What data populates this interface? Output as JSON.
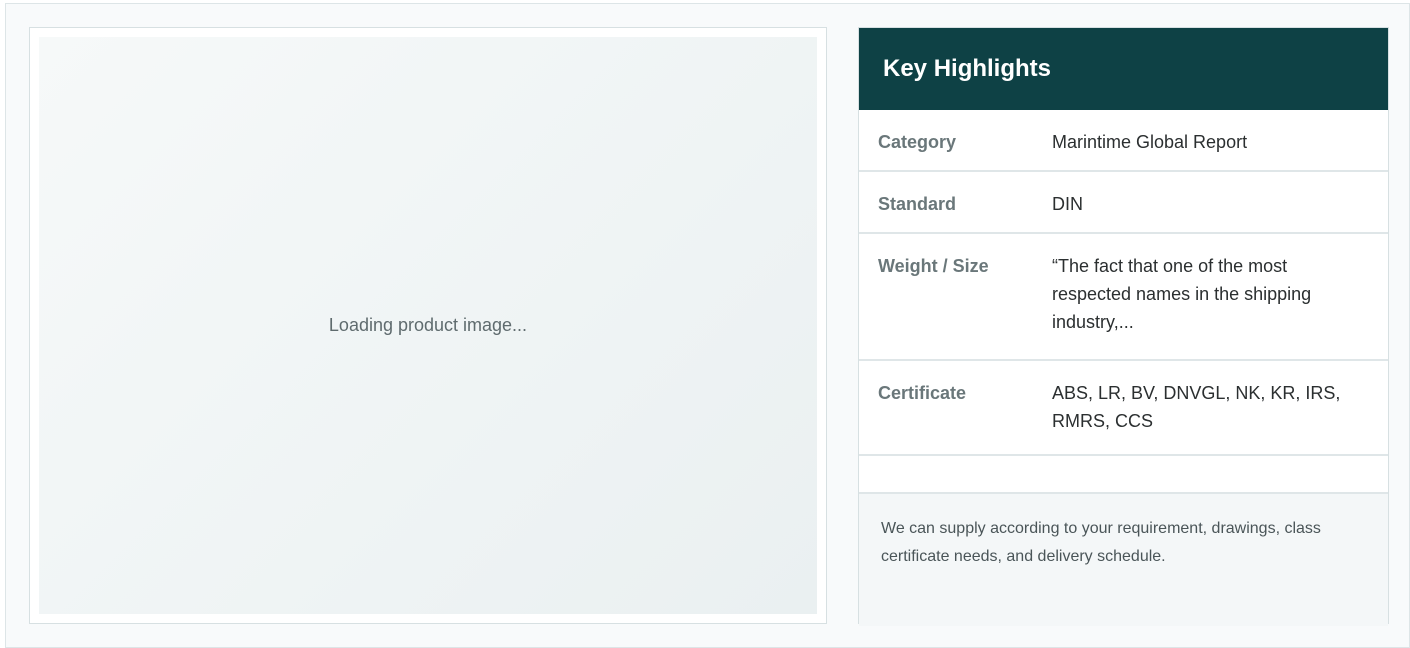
{
  "image_panel": {
    "loading_text": "Loading product image..."
  },
  "highlights": {
    "title": "Key Highlights",
    "rows": [
      {
        "label": "Category",
        "value": "Marintime Global Report"
      },
      {
        "label": "Standard",
        "value": "DIN"
      },
      {
        "label": "Weight / Size",
        "value": "“The fact that one of the most respected names in the shipping industry,..."
      },
      {
        "label": "Certificate",
        "value": "ABS, LR, BV, DNVGL, NK, KR, IRS, RMRS, CCS"
      }
    ],
    "note": "We can supply according to your requirement, drawings, class certificate needs, and delivery schedule."
  }
}
